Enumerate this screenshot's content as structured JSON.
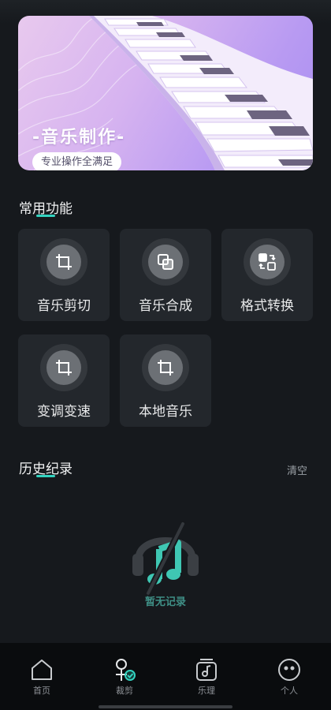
{
  "banner": {
    "title": "-音乐制作-",
    "subtitle": "专业操作全满足"
  },
  "functions": {
    "section_title": "常用功能",
    "items": [
      {
        "label": "音乐剪切",
        "icon": "crop-icon"
      },
      {
        "label": "音乐合成",
        "icon": "merge-icon"
      },
      {
        "label": "格式转换",
        "icon": "format-convert-icon"
      },
      {
        "label": "变调变速",
        "icon": "crop-icon"
      },
      {
        "label": "本地音乐",
        "icon": "crop-icon"
      }
    ]
  },
  "history": {
    "section_title": "历史纪录",
    "clear_label": "清空",
    "empty_text": "暂无记录"
  },
  "tabbar": {
    "items": [
      {
        "label": "首页",
        "icon": "home-icon",
        "active": false
      },
      {
        "label": "裁剪",
        "icon": "trim-icon",
        "active": true
      },
      {
        "label": "乐理",
        "icon": "music-note-icon",
        "active": false
      },
      {
        "label": "个人",
        "icon": "profile-icon",
        "active": false
      }
    ]
  },
  "colors": {
    "background": "#16191d",
    "accent": "#33d3c0",
    "tile": "#23272c"
  }
}
